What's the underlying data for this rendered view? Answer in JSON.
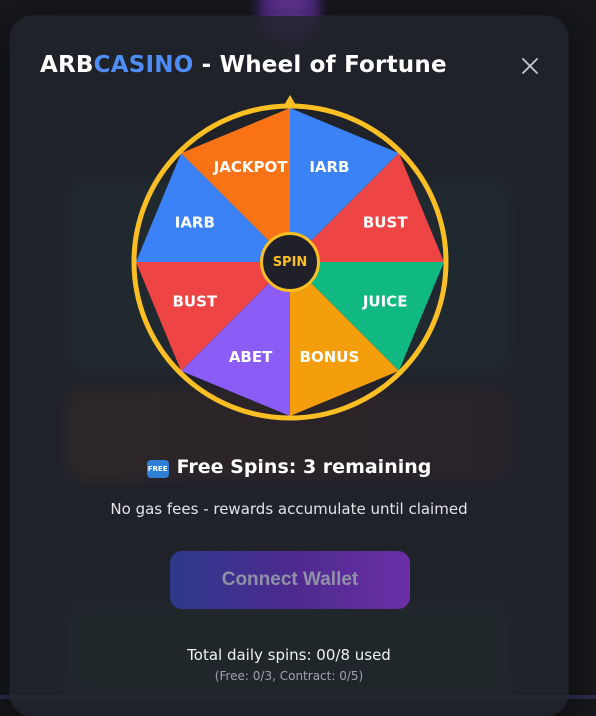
{
  "modal": {
    "title_brand_a": "ARB",
    "title_brand_b": "CASINO",
    "title_rest": " - Wheel of Fortune",
    "close_icon": "close-icon"
  },
  "wheel": {
    "center_label": "SPIN",
    "segments": [
      {
        "label": "IARB",
        "color": "#3b82f6"
      },
      {
        "label": "BUST",
        "color": "#ef4444"
      },
      {
        "label": "JUICE",
        "color": "#10b981"
      },
      {
        "label": "BONUS",
        "color": "#f59e0b"
      },
      {
        "label": "ABET",
        "color": "#8b5cf6"
      },
      {
        "label": "BUST",
        "color": "#ef4444"
      },
      {
        "label": "IARB",
        "color": "#3b82f6"
      },
      {
        "label": "JACKPOT",
        "color": "#f97316"
      }
    ],
    "rim_color": "#fbbf24"
  },
  "free_spins": {
    "badge": "FREE",
    "text": "Free Spins: 3 remaining"
  },
  "subtext": "No gas fees - rewards accumulate until claimed",
  "connect_button": "Connect Wallet",
  "daily": {
    "total": "Total daily spins: 00/8 used",
    "breakdown": "(Free: 0/3, Contract: 0/5)"
  }
}
